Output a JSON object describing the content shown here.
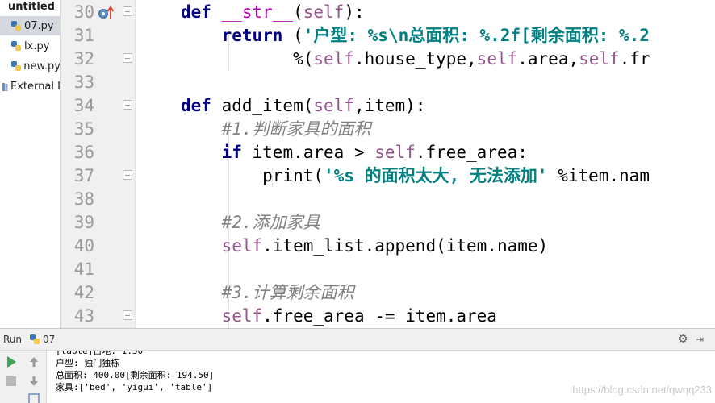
{
  "sidebar": {
    "root": "untitled",
    "files": [
      {
        "name": "07.py",
        "selected": true
      },
      {
        "name": "lx.py",
        "selected": false
      },
      {
        "name": "new.py",
        "selected": false
      }
    ],
    "external": "External L"
  },
  "gutter": {
    "line_numbers": [
      "30",
      "31",
      "32",
      "33",
      "34",
      "35",
      "36",
      "37",
      "38",
      "39",
      "40",
      "41",
      "42",
      "43"
    ]
  },
  "code": [
    [
      {
        "t": "def ",
        "c": "kw"
      },
      {
        "t": "__str__",
        "c": "magic"
      },
      {
        "t": "(",
        "c": ""
      },
      {
        "t": "self",
        "c": "self"
      },
      {
        "t": "):",
        "c": ""
      }
    ],
    [
      {
        "t": "    return ",
        "c": "kw"
      },
      {
        "t": "(",
        "c": ""
      },
      {
        "t": "'户型: %s\\n总面积: %.2f[剩余面积: %.2",
        "c": "str"
      }
    ],
    [
      {
        "t": "           %(",
        "c": ""
      },
      {
        "t": "self",
        "c": "self"
      },
      {
        "t": ".house_type,",
        "c": ""
      },
      {
        "t": "self",
        "c": "self"
      },
      {
        "t": ".area,",
        "c": ""
      },
      {
        "t": "self",
        "c": "self"
      },
      {
        "t": ".fr",
        "c": ""
      }
    ],
    [],
    [
      {
        "t": "def ",
        "c": "kw"
      },
      {
        "t": "add_item(",
        "c": ""
      },
      {
        "t": "self",
        "c": "self"
      },
      {
        "t": ",item):",
        "c": ""
      }
    ],
    [
      {
        "t": "    #1.判断家具的面积",
        "c": "cmt"
      }
    ],
    [
      {
        "t": "    if ",
        "c": "kw"
      },
      {
        "t": "item.area > ",
        "c": ""
      },
      {
        "t": "self",
        "c": "self"
      },
      {
        "t": ".free_area:",
        "c": ""
      }
    ],
    [
      {
        "t": "        print(",
        "c": ""
      },
      {
        "t": "'%s 的面积太大, 无法添加'",
        "c": "str"
      },
      {
        "t": " %item.nam",
        "c": ""
      }
    ],
    [],
    [
      {
        "t": "    #2.添加家具",
        "c": "cmt"
      }
    ],
    [
      {
        "t": "    ",
        "c": ""
      },
      {
        "t": "self",
        "c": "self"
      },
      {
        "t": ".item_list.append(item.name)",
        "c": ""
      }
    ],
    [],
    [
      {
        "t": "    #3.计算剩余面积",
        "c": "cmt"
      }
    ],
    [
      {
        "t": "    ",
        "c": ""
      },
      {
        "t": "self",
        "c": "self"
      },
      {
        "t": ".free_area -= item.area",
        "c": ""
      }
    ]
  ],
  "run": {
    "label": "Run",
    "config": "07",
    "output": [
      "[table]占地: 1.50",
      "户型: 独门独栋",
      "总面积: 400.00[剩余面积: 194.50]",
      "家具:['bed', 'yigui', 'table']"
    ]
  },
  "watermark": "https://blog.csdn.net/qwqq233"
}
